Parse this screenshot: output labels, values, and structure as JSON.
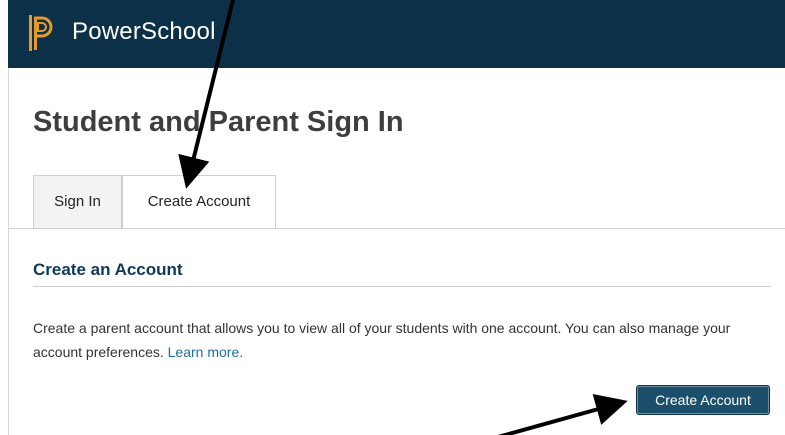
{
  "header": {
    "brand": "PowerSchool",
    "background_color": "#0b3047",
    "logo_icon": "powerschool-logo-icon"
  },
  "page": {
    "title": "Student and Parent Sign In"
  },
  "tabs": [
    {
      "label": "Sign In",
      "active": false
    },
    {
      "label": "Create Account",
      "active": true
    }
  ],
  "section": {
    "title": "Create an Account",
    "description": "Create a parent account that allows you to view all of your students with one account. You can also manage your account preferences.",
    "link_label": "Learn more.",
    "button_label": "Create Account"
  },
  "colors": {
    "section_title": "#0d3a5c",
    "link": "#1f6fa8",
    "button": "#1b4f6b",
    "annotation": "#000000"
  }
}
